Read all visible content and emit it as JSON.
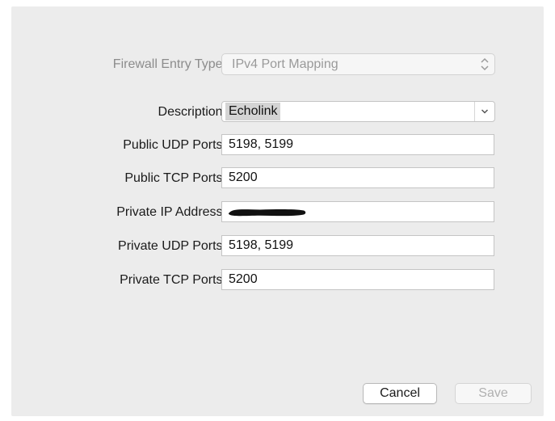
{
  "form": {
    "entry_type": {
      "label": "Firewall Entry Type:",
      "value": "IPv4 Port Mapping"
    },
    "description": {
      "label": "Description:",
      "value": "Echolink"
    },
    "public_udp": {
      "label": "Public UDP Ports:",
      "value": "5198, 5199"
    },
    "public_tcp": {
      "label": "Public TCP Ports:",
      "value": "5200"
    },
    "private_ip": {
      "label": "Private IP Address:",
      "value": ""
    },
    "private_udp": {
      "label": "Private UDP Ports:",
      "value": "5198, 5199"
    },
    "private_tcp": {
      "label": "Private TCP Ports:",
      "value": "5200"
    }
  },
  "buttons": {
    "cancel": "Cancel",
    "save": "Save"
  },
  "icons": {
    "entry_type_stepper": "up-down-chevron-icon",
    "description_dropdown": "chevron-down-icon"
  }
}
